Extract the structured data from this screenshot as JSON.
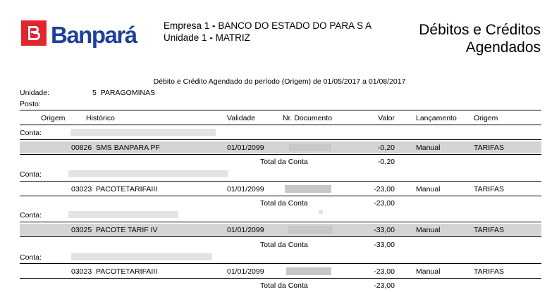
{
  "header": {
    "logo_text": "Banpará",
    "empresa_label": "Empresa 1",
    "empresa_name": "BANCO DO ESTADO DO PARA S A",
    "unidade_label": "Unidade 1",
    "unidade_name": "MATRIZ",
    "title_line1": "Débitos e Créditos",
    "title_line2": "Agendados"
  },
  "report": {
    "period": "Débito e Crédito Agendado do período (Origem) de 01/05/2017 a 01/08/2017",
    "unidade_label": "Unidade:",
    "unidade_value": "5  PARAGOMINAS",
    "posto_label": "Posto:"
  },
  "columns": {
    "origem": "Origem",
    "historico": "Histórico",
    "validade": "Validade",
    "documento": "Nr. Documento",
    "valor": "Valor",
    "lancamento": "Lançamento",
    "origem2": "Origem"
  },
  "conta_label": "Conta:",
  "total_label": "Total da Conta",
  "groups": [
    {
      "historico": "00826  SMS BANPARA PF",
      "validade": "01/01/2099",
      "valor": "-0,20",
      "lancamento": "Manual",
      "origem": "TARIFAS",
      "total": "-0,20"
    },
    {
      "historico": "03023  PACOTETARIFAIII",
      "validade": "01/01/2099",
      "valor": "-23,00",
      "lancamento": "Manual",
      "origem": "TARIFAS",
      "total": "-23,00"
    },
    {
      "historico": "03025  PACOTE TARIF IV",
      "validade": "01/01/2099",
      "valor": "-33,00",
      "lancamento": "Manual",
      "origem": "TARIFAS",
      "total": "-33,00"
    },
    {
      "historico": "03023  PACOTETARIFAIII",
      "validade": "01/01/2099",
      "valor": "-23,00",
      "lancamento": "Manual",
      "origem": "TARIFAS",
      "total": "-23,00"
    }
  ]
}
